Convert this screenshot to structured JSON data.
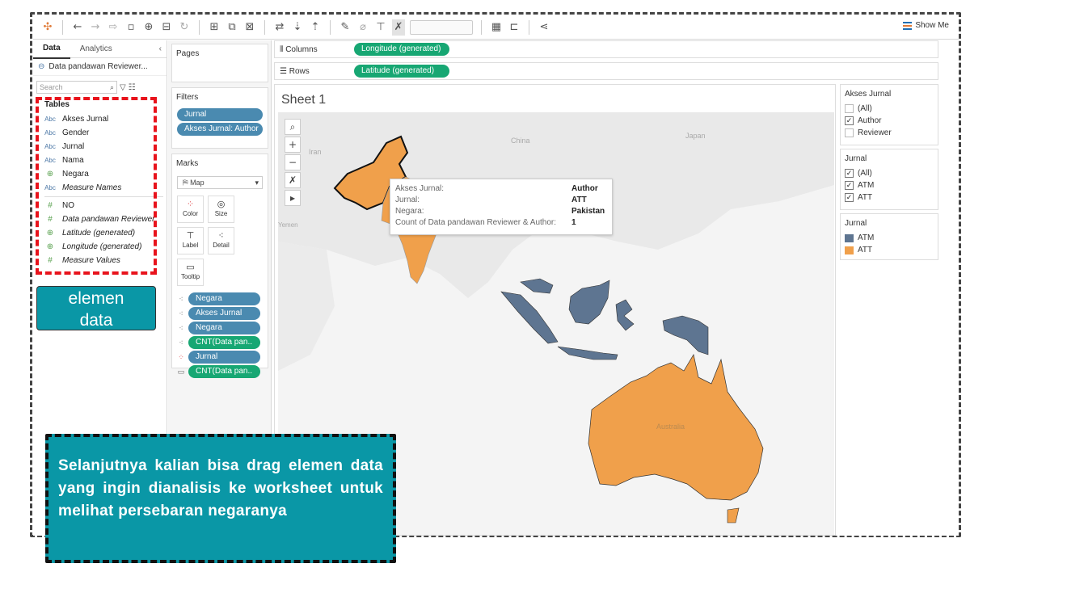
{
  "toolbar": {
    "show_me": "Show Me"
  },
  "data_pane": {
    "tabs": [
      {
        "label": "Data"
      },
      {
        "label": "Analytics"
      }
    ],
    "datasource": "Data pandawan Reviewer...",
    "search_placeholder": "Search",
    "tables_header": "Tables",
    "fields": [
      {
        "type": "Abc",
        "label": "Akses Jurnal"
      },
      {
        "type": "Abc",
        "label": "Gender"
      },
      {
        "type": "Abc",
        "label": "Jurnal"
      },
      {
        "type": "Abc",
        "label": "Nama"
      },
      {
        "type": "globe",
        "label": "Negara"
      },
      {
        "type": "Abc",
        "label": "Measure Names"
      },
      {
        "type": "#",
        "label": "NO"
      },
      {
        "type": "#",
        "label": "Data pandawan Reviewer"
      },
      {
        "type": "globe",
        "label": "Latitude (generated)"
      },
      {
        "type": "globe",
        "label": "Longitude (generated)"
      },
      {
        "type": "#",
        "label": "Measure Values"
      }
    ]
  },
  "annotation_label": {
    "line1": "elemen",
    "line2": "data"
  },
  "pages": {
    "title": "Pages"
  },
  "filters": {
    "title": "Filters",
    "items": [
      "Jurnal",
      "Akses Jurnal: Author"
    ]
  },
  "marks": {
    "title": "Marks",
    "type": "Map",
    "buttons": [
      "Color",
      "Size",
      "Label",
      "Detail",
      "Tooltip"
    ],
    "pills": [
      {
        "label": "Negara",
        "color": "blue"
      },
      {
        "label": "Akses Jurnal",
        "color": "blue"
      },
      {
        "label": "Negara",
        "color": "blue"
      },
      {
        "label": "CNT(Data pan..",
        "color": "green"
      },
      {
        "label": "Jurnal",
        "color": "blue"
      },
      {
        "label": "CNT(Data pan..",
        "color": "green"
      }
    ]
  },
  "shelves": {
    "columns_label": "Columns",
    "columns_pill": "Longitude (generated)",
    "rows_label": "Rows",
    "rows_pill": "Latitude (generated)"
  },
  "sheet": {
    "title": "Sheet 1",
    "map_labels": {
      "china": "China",
      "japan": "Japan",
      "iran": "Iran",
      "yemen": "Yemen",
      "australia": "Australia"
    }
  },
  "tooltip": {
    "rows": [
      {
        "key": "Akses Jurnal:",
        "value": "Author"
      },
      {
        "key": "Jurnal:",
        "value": "ATT"
      },
      {
        "key": "Negara:",
        "value": "Pakistan"
      },
      {
        "key": "Count of Data pandawan Reviewer & Author:",
        "value": "1"
      }
    ]
  },
  "legends": {
    "akses": {
      "title": "Akses Jurnal",
      "items": [
        {
          "label": "(All)",
          "checked": false
        },
        {
          "label": "Author",
          "checked": true
        },
        {
          "label": "Reviewer",
          "checked": false
        }
      ]
    },
    "jurnal_filter": {
      "title": "Jurnal",
      "items": [
        {
          "label": "(All)",
          "checked": true
        },
        {
          "label": "ATM",
          "checked": true
        },
        {
          "label": "ATT",
          "checked": true
        }
      ]
    },
    "jurnal_color": {
      "title": "Jurnal",
      "items": [
        {
          "label": "ATM",
          "color": "#5e7591"
        },
        {
          "label": "ATT",
          "color": "#f0a04b"
        }
      ]
    }
  },
  "callout": {
    "text": "Selanjutnya kalian bisa drag elemen data yang ingin dianalisis ke worksheet untuk melihat persebaran negaranya"
  },
  "colors": {
    "atm": "#5e7591",
    "att": "#f0a04b",
    "pill_blue": "#4a8ab0",
    "pill_green": "#17a773",
    "callout_bg": "#0a97a6",
    "highlight_red": "#e8131c"
  }
}
